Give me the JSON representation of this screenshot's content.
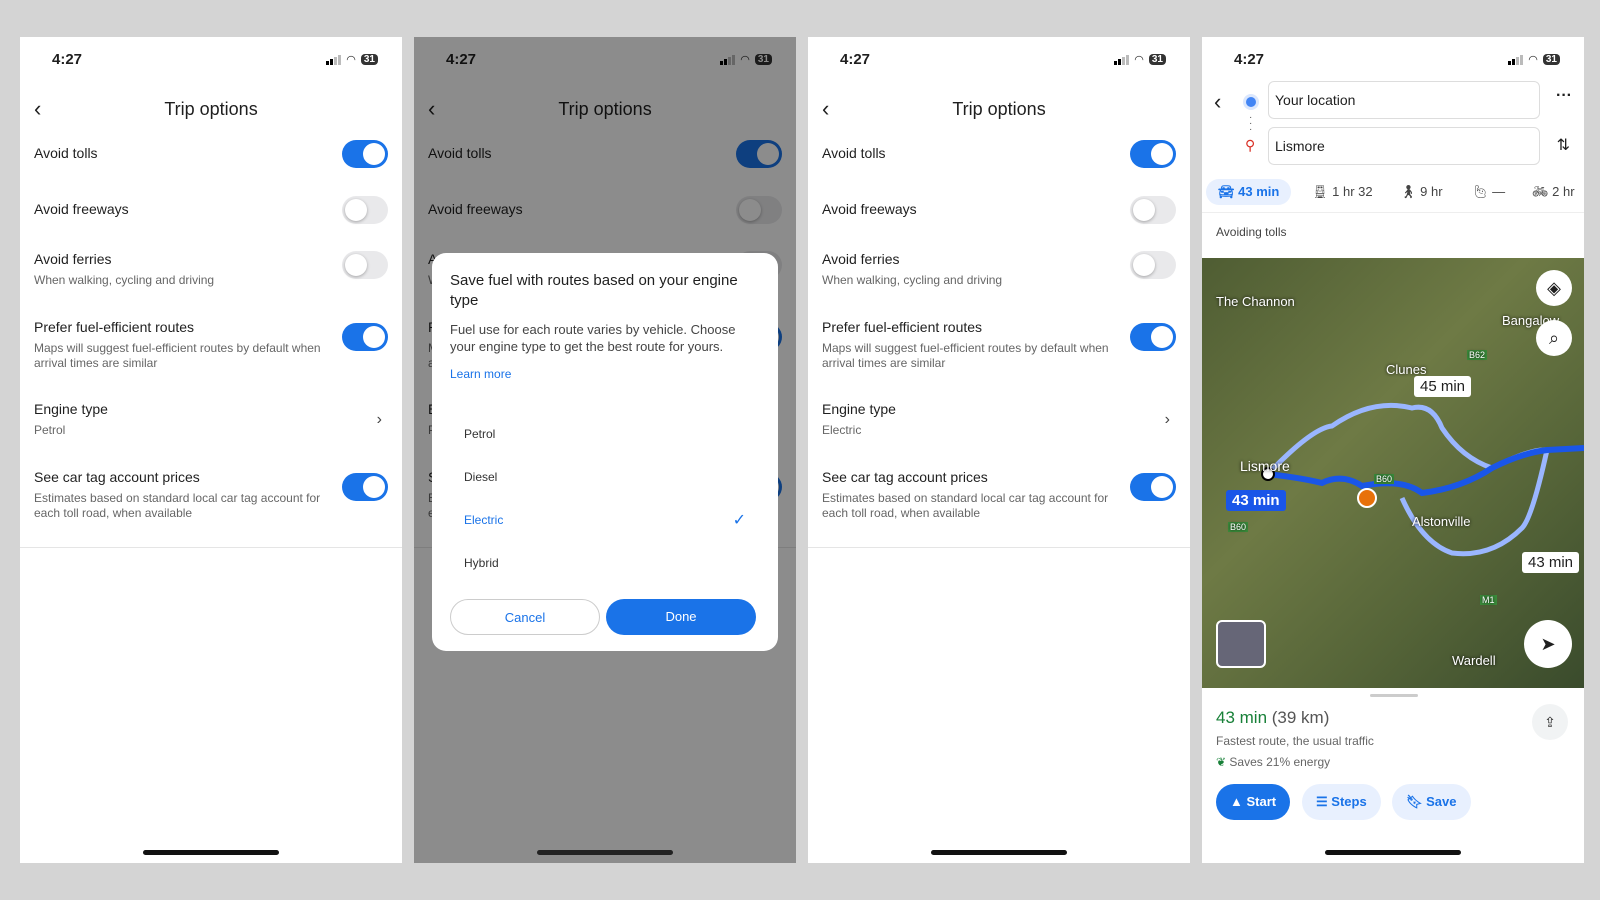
{
  "status": {
    "time": "4:27",
    "battery": "31"
  },
  "trip": {
    "title": "Trip options",
    "options": [
      {
        "label": "Avoid tolls",
        "sub": "",
        "on": true
      },
      {
        "label": "Avoid freeways",
        "sub": "",
        "on": false
      },
      {
        "label": "Avoid ferries",
        "sub": "When walking, cycling and driving",
        "on": false
      },
      {
        "label": "Prefer fuel-efficient routes",
        "sub": "Maps will suggest fuel-efficient routes by default when arrival times are similar",
        "on": true
      },
      {
        "label": "See car tag account prices",
        "sub": "Estimates based on standard local car tag account for each toll road, when available",
        "on": true
      }
    ],
    "engine_label": "Engine type",
    "engine_petrol": "Petrol",
    "engine_electric": "Electric"
  },
  "dialog": {
    "title": "Save fuel with routes based on your engine type",
    "body": "Fuel use for each route varies by vehicle. Choose your engine type to get the best route for yours.",
    "learn_more": "Learn more",
    "options": [
      "Petrol",
      "Diesel",
      "Electric",
      "Hybrid"
    ],
    "selected": "Electric",
    "cancel": "Cancel",
    "done": "Done"
  },
  "directions": {
    "from": "Your location",
    "to": "Lismore",
    "modes": [
      {
        "icon": "car-icon",
        "label": "43 min"
      },
      {
        "icon": "transit-icon",
        "label": "1 hr 32"
      },
      {
        "icon": "walk-icon",
        "label": "9 hr"
      },
      {
        "icon": "ride-hail-icon",
        "label": "—"
      },
      {
        "icon": "bike-icon",
        "label": "2 hr"
      }
    ],
    "note": "Avoiding tolls",
    "map_labels": [
      "The Channon",
      "Bangalow",
      "Clunes",
      "Lismore",
      "Alstonville",
      "Wardell",
      "B62",
      "B60",
      "B60",
      "M1"
    ],
    "route_chips": {
      "main": "43 min",
      "alt1": "45 min",
      "alt2": "43 min"
    },
    "summary": {
      "time": "43 min",
      "distance": "(39 km)",
      "desc": "Fastest route, the usual traffic",
      "eco": "Saves 21% energy"
    },
    "buttons": {
      "start": "Start",
      "steps": "Steps",
      "save": "Save"
    }
  },
  "colors": {
    "accent": "#1a73e8",
    "eco": "#188038"
  }
}
